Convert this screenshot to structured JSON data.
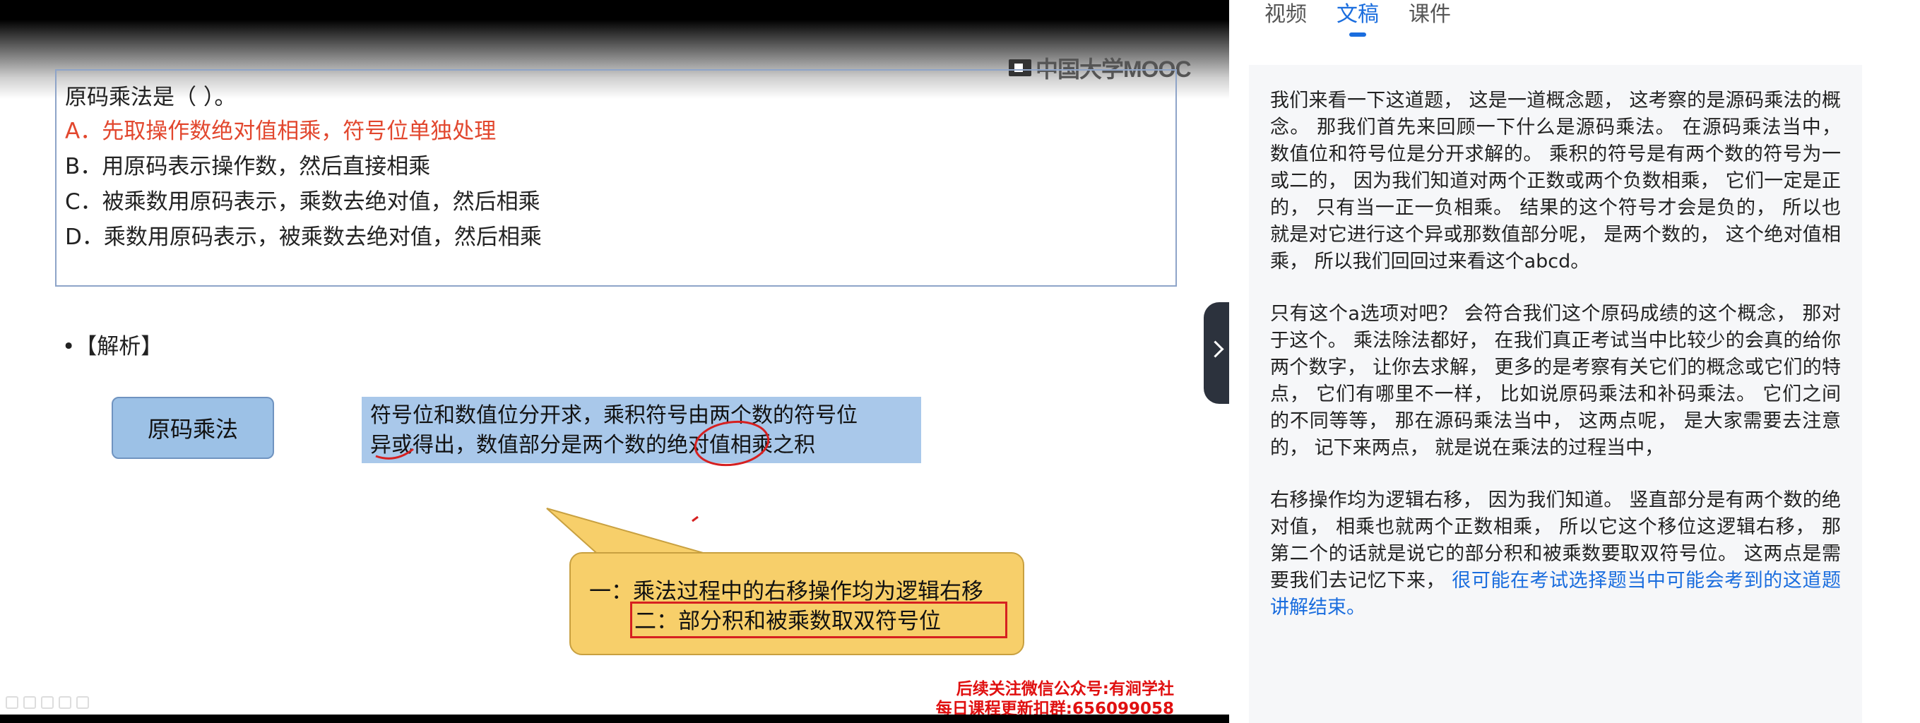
{
  "tabs": [
    "视频",
    "文稿",
    "课件"
  ],
  "active_tab": "文稿",
  "slide": {
    "watermark": "中国大学MOOC",
    "question": "原码乘法是（    ）。",
    "options": [
      "A．先取操作数绝对值相乘，符号位单独处理",
      "B．用原码表示操作数，然后直接相乘",
      "C．被乘数用原码表示，乘数去绝对值，然后相乘",
      "D．乘数用原码表示，被乘数去绝对值，然后相乘"
    ],
    "analysis_label": "•【解析】",
    "concept": "原码乘法",
    "explanation_line1": "符号位和数值位分开求，乘积符号由两个数的符号位",
    "explanation_line2": "异或得出，数值部分是两个数的绝对值相乘之积",
    "callout_line1": "一：乘法过程中的右移操作均为逻辑右移",
    "callout_line2": "二：部分积和被乘数取双符号位",
    "promo_line1": "后续关注微信公众号:有涧学社",
    "promo_line2": "每日课程更新扣群:656099058"
  },
  "transcript": {
    "p1": "我们来看一下这道题， 这是一道概念题， 这考察的是源码乘法的概念。 那我们首先来回顾一下什么是源码乘法。 在源码乘法当中， 数值位和符号位是分开求解的。 乘积的符号是有两个数的符号为一或二的， 因为我们知道对两个正数或两个负数相乘， 它们一定是正的， 只有当一正一负相乘。 结果的这个符号才会是负的， 所以也就是对它进行这个异或那数值部分呢， 是两个数的， 这个绝对值相乘， 所以我们回回过来看这个abcd。",
    "p2": "只有这个a选项对吧？ 会符合我们这个原码成绩的这个概念， 那对于这个。 乘法除法都好， 在我们真正考试当中比较少的会真的给你两个数字， 让你去求解， 更多的是考察有关它们的概念或它们的特点， 它们有哪里不一样， 比如说原码乘法和补码乘法。 它们之间的不同等等， 那在源码乘法当中， 这两点呢， 是大家需要去注意的， 记下来两点， 就是说在乘法的过程当中，",
    "p3_a": "右移操作均为逻辑右移， 因为我们知道。 竖直部分是有两个数的绝对值， 相乘也就两个正数相乘， 所以它这个移位这逻辑右移， 那第二个的话就是说它的部分积和被乘数要取双符号位。 这两点是需要我们去记忆下来， ",
    "p3_b": "很可能在考试选择题当中可能会考到的这道题讲解结束。"
  }
}
